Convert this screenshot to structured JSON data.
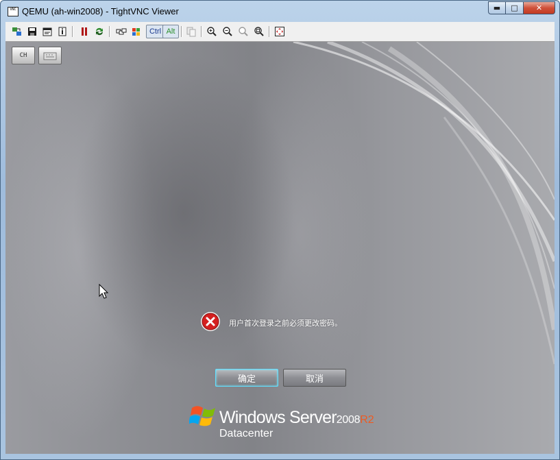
{
  "window": {
    "title": "QEMU (ah-win2008) - TightVNC Viewer",
    "app_icon_text": "VNC",
    "min_glyph": "▬",
    "max_glyph": "□",
    "close_glyph": "✕"
  },
  "toolbar": {
    "ctrl_label": "Ctrl",
    "alt_label": "Alt",
    "icons": [
      "new-connection-icon",
      "save-icon",
      "options-icon",
      "info-icon",
      "pause-icon",
      "refresh-icon",
      "send-ctrl-alt-del-icon",
      "send-ctrl-esc-icon",
      "copy-clipboard-icon",
      "zoom-in-icon",
      "zoom-out-icon",
      "zoom-100-icon",
      "zoom-auto-icon",
      "fullscreen-icon"
    ]
  },
  "remote": {
    "lang_button": "CH",
    "error_message": "用户首次登录之前必须更改密码。",
    "ok_button": "确定",
    "cancel_button": "取消",
    "brand": {
      "product": "Windows Server",
      "version": "2008",
      "release": "R2",
      "edition": "Datacenter"
    }
  },
  "colors": {
    "error_red": "#d42020",
    "ok_focus": "#5fe0ff",
    "r2_orange": "#ee5a22",
    "close_red": "#c23a22"
  }
}
